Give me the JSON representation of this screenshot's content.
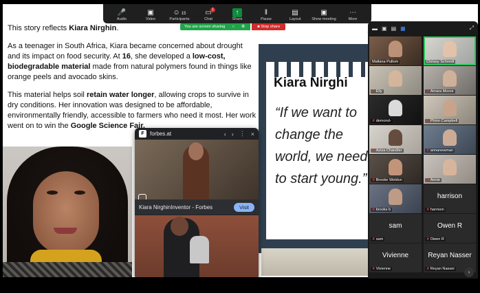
{
  "toolbar": {
    "items": [
      {
        "label": "Audio",
        "icon": "microphone-icon"
      },
      {
        "label": "Video",
        "icon": "video-camera-icon"
      },
      {
        "label": "Participants",
        "icon": "participants-icon",
        "count": "15"
      },
      {
        "label": "Chat",
        "icon": "chat-icon",
        "badge": "1"
      },
      {
        "label": "Share",
        "icon": "share-screen-icon"
      },
      {
        "label": "Pause",
        "icon": "pause-icon"
      },
      {
        "label": "Layout",
        "icon": "layout-icon"
      },
      {
        "label": "Show meeting",
        "icon": "show-meeting-icon"
      },
      {
        "label": "More",
        "icon": "more-icon"
      }
    ]
  },
  "share_status": {
    "message": "You are screen sharing",
    "stop_label": "Stop share",
    "colors": {
      "sharing": "#22a34a",
      "stop": "#d12b2b"
    }
  },
  "slide": {
    "paragraphs": [
      {
        "segments": [
          {
            "t": "This story reflects "
          },
          {
            "t": "Kiara Nirghin",
            "b": true
          },
          {
            "t": "."
          }
        ]
      },
      {
        "segments": [
          {
            "t": "As a teenager in South Africa, Kiara became concerned about drought and its impact on food security. At "
          },
          {
            "t": "16",
            "b": true
          },
          {
            "t": ", she developed a "
          },
          {
            "t": "low-cost, biodegradable material",
            "b": true
          },
          {
            "t": " made from natural polymers found in things like orange peels and avocado skins."
          }
        ]
      },
      {
        "segments": [
          {
            "t": "This material helps soil "
          },
          {
            "t": "retain water longer",
            "b": true
          },
          {
            "t": ", allowing crops to survive in dry conditions. Her innovation was designed to be affordable, environmentally friendly, accessible to farmers who need it most. Her work went on to win the "
          },
          {
            "t": "Google Science Fair.",
            "b": true
          }
        ]
      }
    ],
    "card_name": "Kiara Nirghi",
    "quote": "“If we want to change the world, we need to start young.”"
  },
  "browser_popup": {
    "domain": "forbes.at",
    "caption": "Kiara NirghinInventor - Forbes",
    "visit_label": "Visit",
    "favicon_letter": "F"
  },
  "gallery": {
    "tiles": [
      {
        "name": "Mallana Pullom",
        "type": "video",
        "c1": "#7a5d4a",
        "c2": "#3a2c22",
        "skin": "#c59a7e",
        "muted": false
      },
      {
        "name": "Chrissy Schmidt",
        "type": "video",
        "c1": "#d8d6d0",
        "c2": "#9fa2a0",
        "skin": "#e6c3a8",
        "muted": false,
        "active": true
      },
      {
        "name": "Elly",
        "type": "video",
        "c1": "#c9c2b6",
        "c2": "#8e8a80",
        "skin": "#d8b79b",
        "muted": true
      },
      {
        "name": "Amara Moore",
        "type": "video",
        "c1": "#b6b1ab",
        "c2": "#6e6a66",
        "skin": "#d6b49a",
        "muted": true
      },
      {
        "name": "demond-",
        "type": "video",
        "c1": "#2b2b2b",
        "c2": "#111111",
        "skin": "#f0f0f0",
        "muted": true
      },
      {
        "name": "Phinn Campbell",
        "type": "video",
        "c1": "#cfc7bb",
        "c2": "#8b8478",
        "skin": "#caa389",
        "muted": true
      },
      {
        "name": "Aziza Chandler",
        "type": "video",
        "c1": "#d7d3cd",
        "c2": "#a8a39c",
        "skin": "#5b3f31",
        "muted": true
      },
      {
        "name": "annanewman",
        "type": "video",
        "c1": "#6e7d8e",
        "c2": "#3c4654",
        "skin": "#d9b49a",
        "muted": true
      },
      {
        "name": "Brooke Weldon",
        "type": "video",
        "c1": "#5a5048",
        "c2": "#2e2824",
        "skin": "#cf9f82",
        "muted": true
      },
      {
        "name": "Annie",
        "type": "video",
        "c1": "#c8c2bc",
        "c2": "#928b84",
        "skin": "#dcb69b",
        "muted": true
      },
      {
        "name": "brooks b",
        "type": "video",
        "c1": "#6b7383",
        "c2": "#3b4250",
        "skin": "#caa288",
        "muted": true
      },
      {
        "name": "harrison",
        "type": "name",
        "muted": true
      },
      {
        "name": "sam",
        "type": "name",
        "muted": true
      },
      {
        "name": "Owen R",
        "type": "name",
        "muted": true
      },
      {
        "name": "Vivienne",
        "type": "name",
        "muted": true
      },
      {
        "name": "Reyan Nasser",
        "type": "name",
        "muted": true
      }
    ]
  }
}
